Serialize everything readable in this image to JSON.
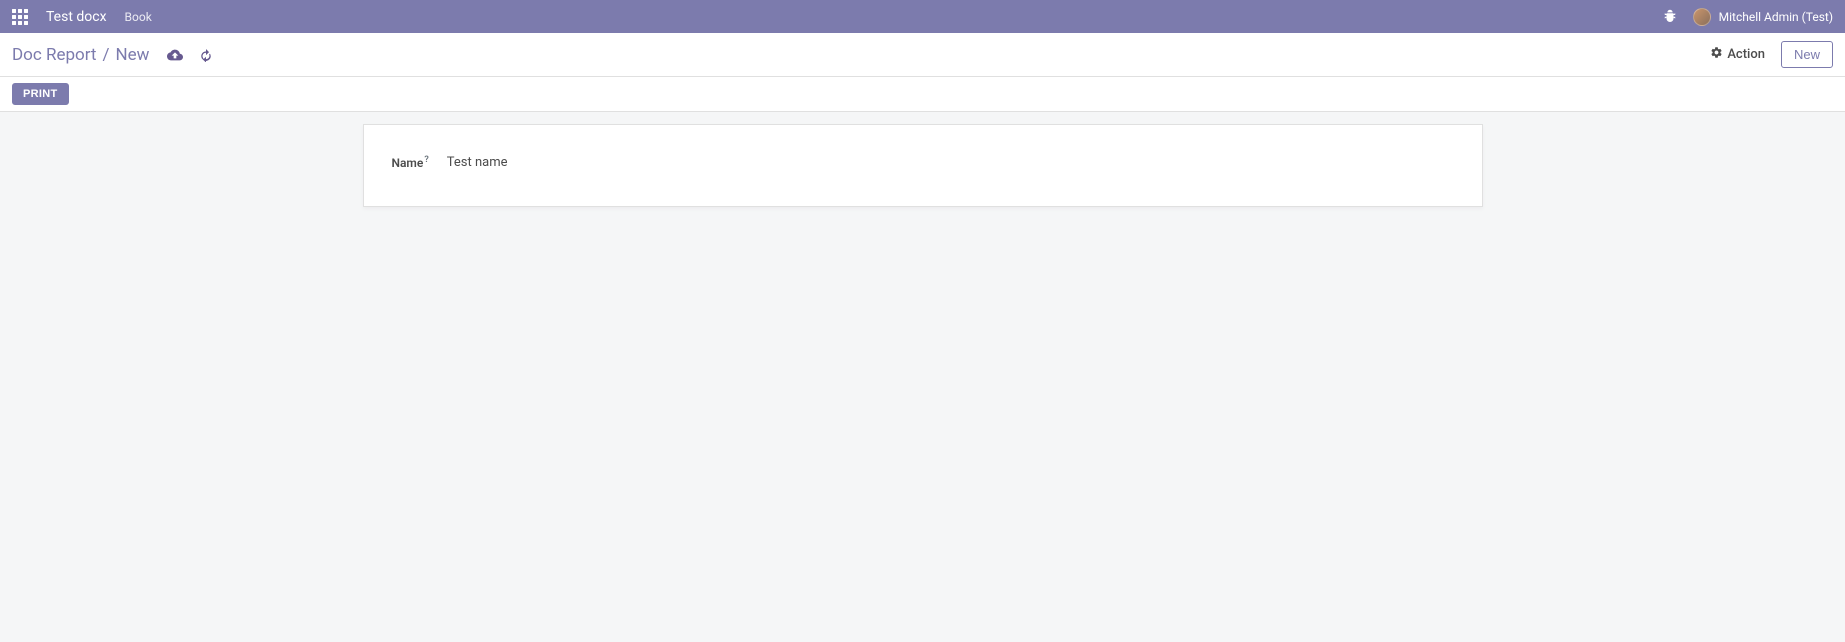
{
  "navbar": {
    "brand": "Test docx",
    "menu_items": [
      "Book"
    ],
    "user_name": "Mitchell Admin (Test)"
  },
  "control_panel": {
    "breadcrumb_root": "Doc Report",
    "breadcrumb_current": "New",
    "action_label": "Action",
    "new_label": "New"
  },
  "status": {
    "print_label": "PRINT"
  },
  "form": {
    "name_label": "Name",
    "name_value": "Test name"
  }
}
